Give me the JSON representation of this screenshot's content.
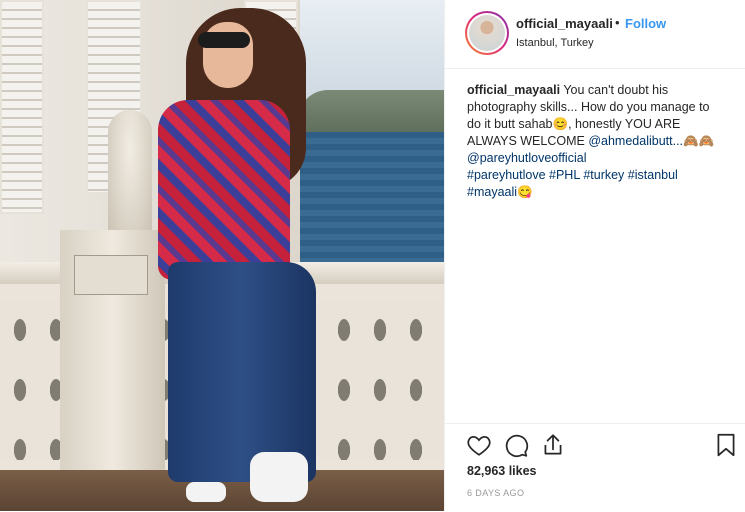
{
  "post": {
    "username": "official_mayaali",
    "separator": "•",
    "follow_label": "Follow",
    "location": "Istanbul, Turkey"
  },
  "caption": {
    "username": "official_mayaali",
    "text_1": " You can't doubt his photography skills... How do you manage to do it butt sahab",
    "emoji_1": "😊",
    "text_2": ", honestly YOU ARE ALWAYS WELCOME ",
    "mention_1": "@ahmedalibutt...",
    "emoji_2": "🙈🙈",
    "mention_2": "@pareyhutloveofficial",
    "hashtag_1": "#pareyhutlove",
    "hashtag_2": "#PHL",
    "hashtag_3": "#turkey",
    "hashtag_4": "#istanbul",
    "hashtag_5": "#mayaali",
    "emoji_3": "😋"
  },
  "stats": {
    "likes": "82,963 likes",
    "timestamp": "6 DAYS AGO"
  },
  "icons": {
    "like": "heart-icon",
    "comment": "comment-icon",
    "share": "share-icon",
    "save": "bookmark-icon"
  },
  "colors": {
    "link": "#3897f0",
    "hashtag": "#003569",
    "text": "#262626",
    "muted": "#999999"
  }
}
